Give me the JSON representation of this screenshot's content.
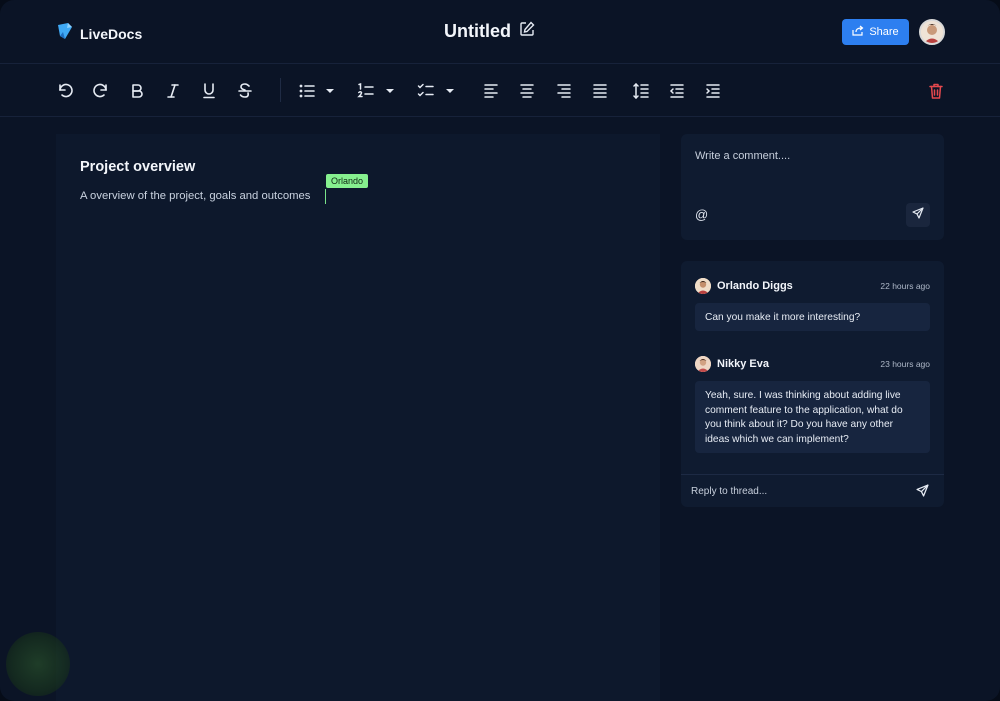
{
  "header": {
    "brand": "LiveDocs",
    "doc_title": "Untitled",
    "share_label": "Share"
  },
  "toolbar": {
    "tools": [
      "undo-icon",
      "redo-icon",
      "bold-icon",
      "italic-icon",
      "underline-icon",
      "strikethrough-icon",
      "bullet-list-icon",
      "numbered-list-icon",
      "checklist-icon",
      "align-left-icon",
      "align-center-icon",
      "align-right-icon",
      "align-justify-icon",
      "line-height-icon",
      "outdent-icon",
      "indent-icon",
      "trash-icon"
    ],
    "delete_color": "#e5484d"
  },
  "editor": {
    "heading": "Project overview",
    "paragraph": "A overview of the project, goals and outcomes",
    "cursor_user": "Orlando",
    "cursor_color": "#86f08f"
  },
  "composer": {
    "placeholder": "Write a comment....",
    "mention_symbol": "@"
  },
  "thread": {
    "comments": [
      {
        "author": "Orlando Diggs",
        "time": "22 hours ago",
        "text": "Can you make it more interesting?"
      },
      {
        "author": "Nikky Eva",
        "time": "23 hours ago",
        "text": "Yeah, sure. I was thinking about adding live comment feature to the application, what do you think about it? Do you have any other ideas which we can implement?"
      }
    ],
    "reply_placeholder": "Reply to thread..."
  },
  "colors": {
    "accent": "#2d7ff0",
    "background": "#0b1426"
  }
}
